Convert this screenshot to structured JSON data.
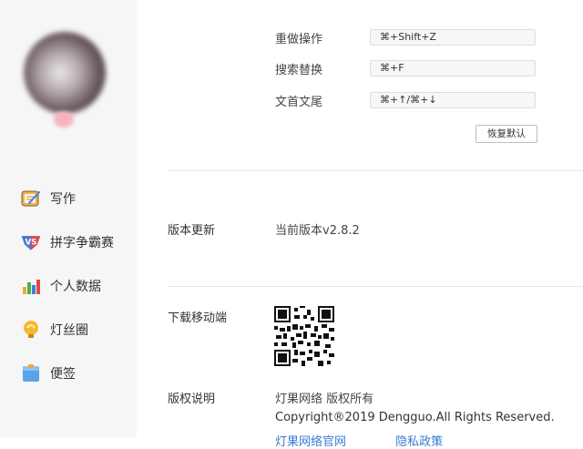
{
  "sidebar": {
    "items": [
      {
        "label": "写作",
        "icon": "writing-icon"
      },
      {
        "label": "拼字争霸赛",
        "icon": "vs-icon"
      },
      {
        "label": "个人数据",
        "icon": "bar-chart-icon"
      },
      {
        "label": "灯丝圈",
        "icon": "bulb-icon"
      },
      {
        "label": "便签",
        "icon": "note-icon"
      }
    ]
  },
  "shortcuts": [
    {
      "label": "重做操作",
      "value": "⌘+Shift+Z"
    },
    {
      "label": "搜索替换",
      "value": "⌘+F"
    },
    {
      "label": "文首文尾",
      "value": "⌘+↑/⌘+↓"
    }
  ],
  "reset_button": "恢复默认",
  "version": {
    "label": "版本更新",
    "value": "当前版本v2.8.2"
  },
  "download": {
    "label": "下载移动端",
    "qr_icon": "qr-code-icon"
  },
  "copyright": {
    "label": "版权说明",
    "owner": "灯果网络 版权所有",
    "notice": "Copyright®2019 Dengguo.All Rights Reserved.",
    "link1": "灯果网络官网",
    "link2": "隐私政策"
  }
}
